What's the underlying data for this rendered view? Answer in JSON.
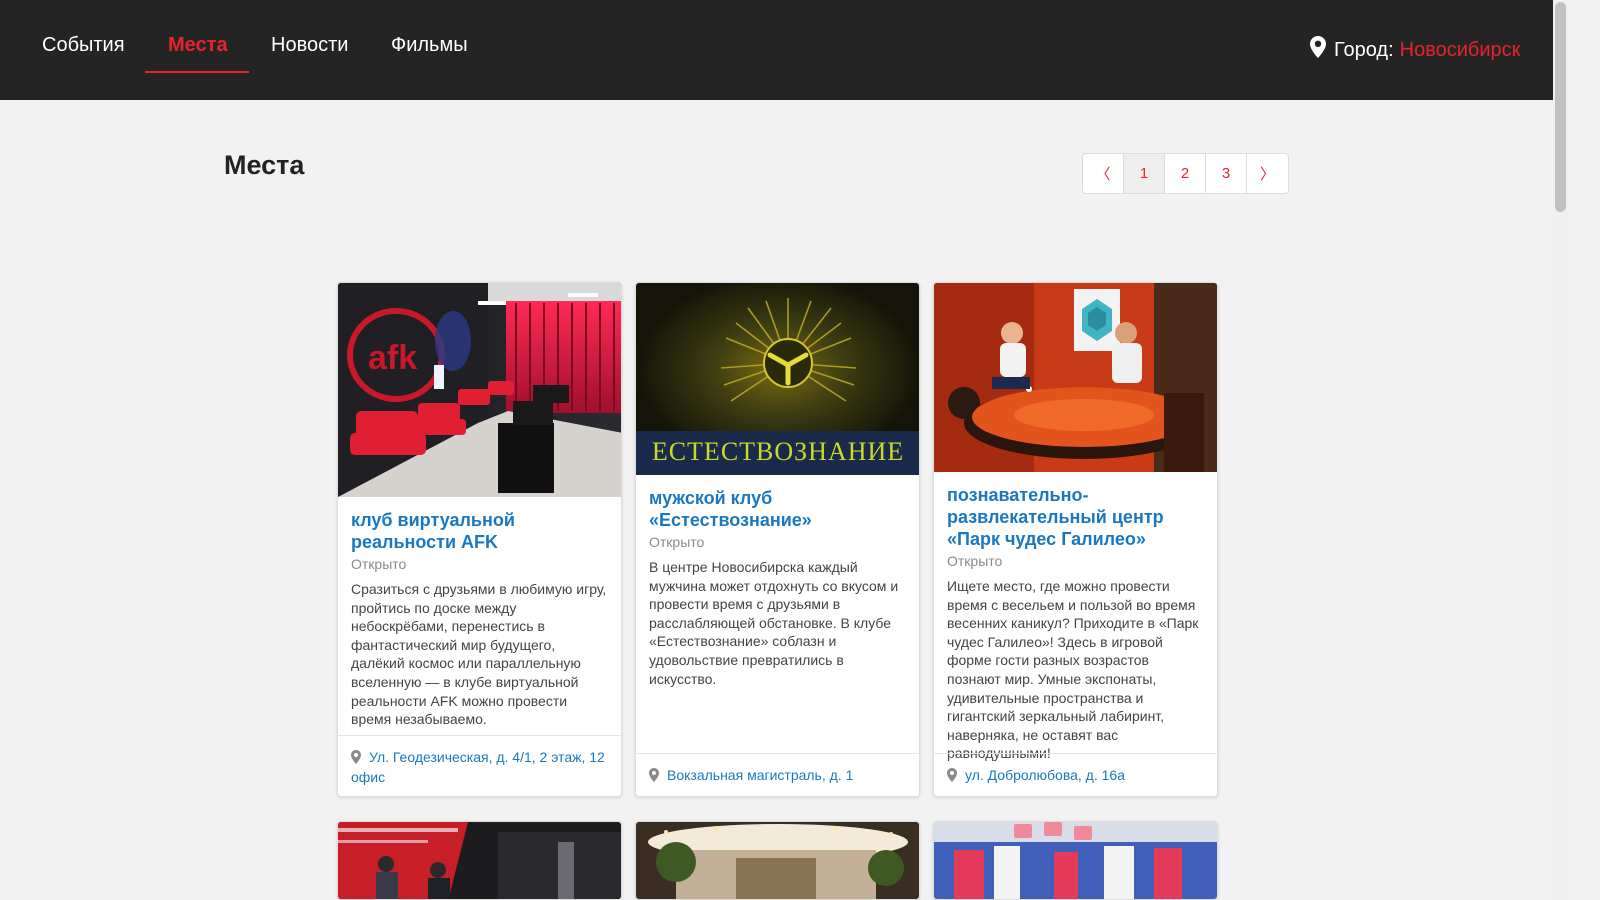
{
  "nav": {
    "items": [
      {
        "label": "События"
      },
      {
        "label": "Места"
      },
      {
        "label": "Новости"
      },
      {
        "label": "Фильмы"
      }
    ]
  },
  "city": {
    "label": "Город:",
    "name": "Новосибирск"
  },
  "page": {
    "title": "Места"
  },
  "pagination": {
    "prev": "〈",
    "pages": [
      "1",
      "2",
      "3"
    ],
    "next": "〉",
    "current": "1"
  },
  "cards": [
    {
      "title": "клуб виртуальной реальности AFK",
      "status": "Открыто",
      "description": "Сразиться с друзьями в любимую игру, пройтись по доске между небоскрёбами, перенестись в фантастический мир будущего, далёкий космос или параллельную вселенную — в клубе виртуальной реальности AFK можно провести время незабываемо.",
      "address": "Ул. Геодезическая, д. 4/1, 2 этаж, 12 офис",
      "image": "vr-club-photo"
    },
    {
      "title": "мужской клуб «Естествознание»",
      "status": "Открыто",
      "description": "В центре Новосибирска каждый мужчина может отдохнуть со вкусом и провести время с друзьями в расслабляющей обстановке. В клубе «Естествознание» соблазн и удовольствие превратились в искусство.",
      "address": "Вокзальная магистраль, д. 1",
      "image": "mens-club-photo",
      "sign_text": "ЕСТЕСТВОЗНАНИЕ"
    },
    {
      "title": "познавательно-развлекательный центр «Парк чудес Галилео»",
      "status": "Открыто",
      "description": "Ищете место, где можно провести время с весельем и пользой во время весенних каникул? Приходите в «Парк чудес Галилео»! Здесь в игровой форме гости разных возрастов познают мир. Умные экспонаты, удивительные пространства и гигантский зеркальный лабиринт, наверняка, не оставят вас равнодушными!",
      "address": "ул. Добролюбова, д. 16а",
      "image": "galileo-park-photo"
    }
  ],
  "colors": {
    "accent": "#e8232b",
    "link": "#1a78c2",
    "header_bg": "#242424",
    "page_bg": "#f2f2f2"
  }
}
